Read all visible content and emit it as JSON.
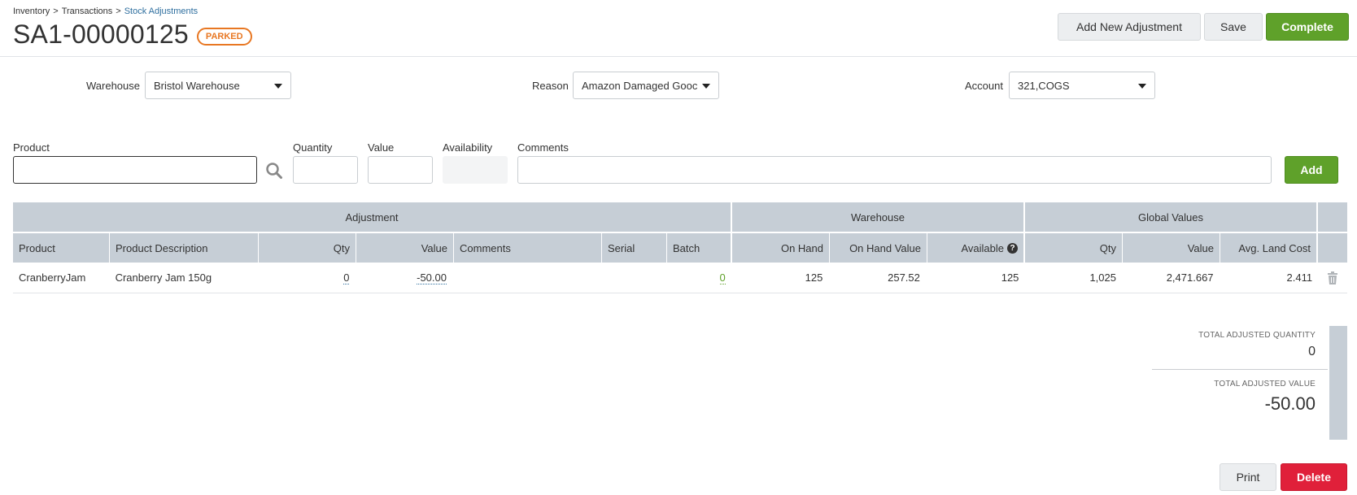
{
  "breadcrumb": {
    "items": [
      "Inventory",
      "Transactions"
    ],
    "current": "Stock Adjustments",
    "separator": ">"
  },
  "header": {
    "title": "SA1-00000125",
    "status": "PARKED",
    "status_color": "#e87722"
  },
  "actions": {
    "add_new": "Add New Adjustment",
    "save": "Save",
    "complete": "Complete",
    "print": "Print",
    "delete": "Delete"
  },
  "fields": {
    "warehouse_label": "Warehouse",
    "warehouse_value": "Bristol Warehouse",
    "reason_label": "Reason",
    "reason_value": "Amazon Damaged Gooc",
    "account_label": "Account",
    "account_value": "321,COGS"
  },
  "entry": {
    "product_label": "Product",
    "quantity_label": "Quantity",
    "value_label": "Value",
    "availability_label": "Availability",
    "comments_label": "Comments",
    "add_label": "Add"
  },
  "grid": {
    "groups": [
      "Adjustment",
      "Warehouse",
      "Global Values"
    ],
    "columns": [
      "Product",
      "Product Description",
      "Qty",
      "Value",
      "Comments",
      "Serial",
      "Batch",
      "On Hand",
      "On Hand Value",
      "Available",
      "Qty",
      "Value",
      "Avg. Land Cost"
    ],
    "rows": [
      {
        "product": "CranberryJam",
        "description": "Cranberry Jam 150g",
        "qty": "0",
        "value": "-50.00",
        "comments": "",
        "serial": "",
        "batch": "0",
        "on_hand": "125",
        "on_hand_value": "257.52",
        "available": "125",
        "global_qty": "1,025",
        "global_value": "2,471.667",
        "avg_land_cost": "2.411"
      }
    ]
  },
  "totals": {
    "quantity_label": "TOTAL ADJUSTED QUANTITY",
    "quantity_value": "0",
    "value_label": "TOTAL ADJUSTED VALUE",
    "value_value": "-50.00"
  },
  "colors": {
    "primary_green": "#5fa12a",
    "danger_red": "#e0203a",
    "header_grey": "#c6ced6",
    "link_blue": "#2f6f9f"
  }
}
